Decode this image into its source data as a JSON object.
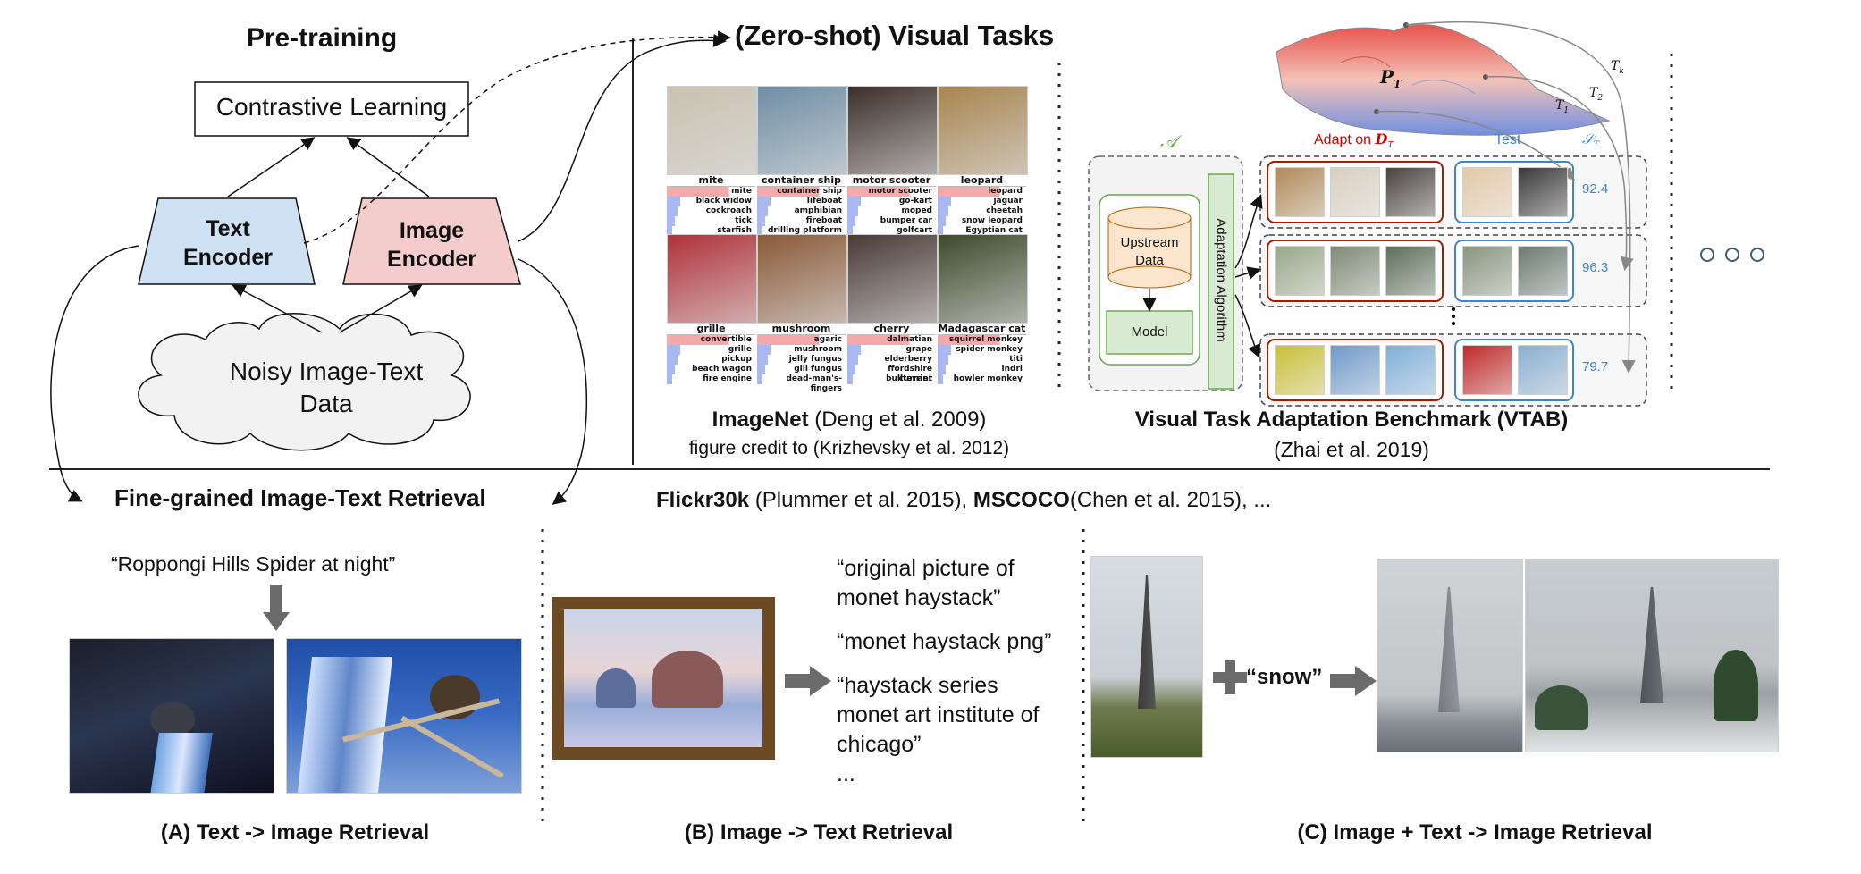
{
  "pretraining": {
    "title": "Pre-training",
    "objective": "Contrastive Learning",
    "text_encoder": [
      "Text",
      "Encoder"
    ],
    "image_encoder": [
      "Image",
      "Encoder"
    ],
    "data": [
      "Noisy Image-Text",
      "Data"
    ]
  },
  "zero_shot": {
    "title": "(Zero-shot) Visual Tasks"
  },
  "imagenet": {
    "grid_top": [
      {
        "label": "mite",
        "preds": [
          "mite",
          "black widow",
          "cockroach",
          "tick",
          "starfish"
        ],
        "color": "#c9c2b0"
      },
      {
        "label": "container ship",
        "preds": [
          "container ship",
          "lifeboat",
          "amphibian",
          "fireboat",
          "drilling platform"
        ],
        "color": "#6f8ea6"
      },
      {
        "label": "motor scooter",
        "preds": [
          "motor scooter",
          "go-kart",
          "moped",
          "bumper car",
          "golfcart"
        ],
        "color": "#3b2f2a"
      },
      {
        "label": "leopard",
        "preds": [
          "leopard",
          "jaguar",
          "cheetah",
          "snow leopard",
          "Egyptian cat"
        ],
        "color": "#a88550"
      }
    ],
    "grid_bottom": [
      {
        "label": "grille",
        "preds": [
          "convertible",
          "grille",
          "pickup",
          "beach wagon",
          "fire engine"
        ],
        "color": "#b0323a"
      },
      {
        "label": "mushroom",
        "preds": [
          "agaric",
          "mushroom",
          "jelly fungus",
          "gill fungus",
          "dead-man's-fingers"
        ],
        "color": "#8a5a38"
      },
      {
        "label": "cherry",
        "preds": [
          "dalmatian",
          "grape",
          "elderberry",
          "ffordshire bullterrier",
          "currant"
        ],
        "color": "#4a3a36"
      },
      {
        "label": "Madagascar cat",
        "preds": [
          "squirrel monkey",
          "spider monkey",
          "titi",
          "indri",
          "howler monkey"
        ],
        "color": "#3d4a2c"
      }
    ],
    "caption_bold": "ImageNet",
    "caption_rest": " (Deng et al. 2009)",
    "credit": "figure credit to (Krizhevsky et al. 2012)"
  },
  "vtab": {
    "algo_symbol": "𝒜",
    "upstream": [
      "Upstream",
      "Data"
    ],
    "model": "Model",
    "adaptation": "Adaptation Algorithm",
    "adapt_on": "Adapt on ",
    "adapt_sym": "D",
    "adapt_sub": "T",
    "test_label": "Test",
    "score_symbol": "𝒮",
    "score_sub": "T",
    "dist_P": "P",
    "dist_sub": "T",
    "task_labels": [
      {
        "t": "T",
        "s": "k"
      },
      {
        "t": "T",
        "s": "2"
      },
      {
        "t": "T",
        "s": "1"
      }
    ],
    "rows": [
      {
        "score": "92.4",
        "kind": "pets"
      },
      {
        "score": "96.3",
        "kind": "satellite"
      },
      {
        "score": "79.7",
        "kind": "3d"
      }
    ],
    "caption_bold": "Visual Task Adaptation Benchmark (VTAB)",
    "caption_rest": "(Zhai et al. 2019)"
  },
  "retrieval": {
    "title": "Fine-grained Image-Text Retrieval",
    "datasets_bold1": "Flickr30k",
    "datasets_rest1": " (Plummer et al. 2015), ",
    "datasets_bold2": "MSCOCO",
    "datasets_rest2": "(Chen et al. 2015), ...",
    "a": {
      "query": "“Roppongi Hills Spider at night”",
      "label": "(A) Text -> Image Retrieval"
    },
    "b": {
      "results": [
        "“original picture of",
        "monet haystack”",
        "“monet haystack png”",
        "“haystack series",
        "monet art institute of",
        "chicago”",
        "..."
      ],
      "label": "(B) Image -> Text Retrieval"
    },
    "c": {
      "open_quote": "“",
      "keyword": "snow",
      "close_quote": "”",
      "label": "(C) Image + Text -> Image Retrieval"
    }
  },
  "ellipsis_dots": "○ ○ ○",
  "colors": {
    "text_encoder": "#cfe2f3",
    "image_encoder": "#f4cccc",
    "cloud": "#f2f2f2",
    "vtab_green": "#d9ead3",
    "accent_red": "#cc0000",
    "accent_blue": "#3d85c6",
    "arrow_gray": "#666666"
  }
}
